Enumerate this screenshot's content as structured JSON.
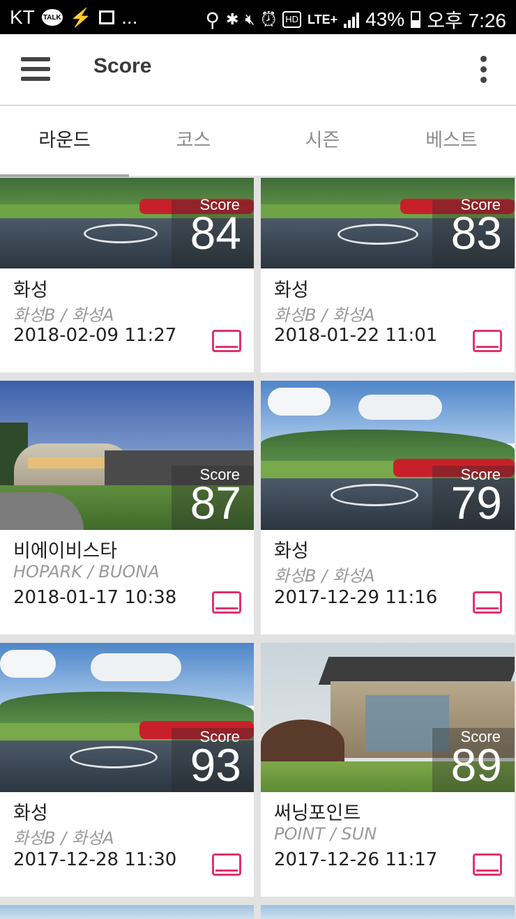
{
  "status_bar": {
    "carrier": "KT",
    "talk": "TALK",
    "more": "...",
    "hd": "HD",
    "lte": "LTE+",
    "battery": "43%",
    "time": "오후 7:26"
  },
  "app_bar": {
    "title": "Score"
  },
  "tabs": [
    {
      "label": "라운드",
      "active": true
    },
    {
      "label": "코스",
      "active": false
    },
    {
      "label": "시즌",
      "active": false
    },
    {
      "label": "베스트",
      "active": false
    }
  ],
  "score_label": "Score",
  "cards": [
    {
      "score": "84",
      "club": "화성",
      "course": "화성B / 화성A",
      "date": "2018-02-09 11:27",
      "scene": "fountain"
    },
    {
      "score": "83",
      "club": "화성",
      "course": "화성B / 화성A",
      "date": "2018-01-22 11:01",
      "scene": "fountain"
    },
    {
      "score": "87",
      "club": "비에이비스타",
      "course": "HOPARK / BUONA",
      "date": "2018-01-17 10:38",
      "scene": "clubhouse"
    },
    {
      "score": "79",
      "club": "화성",
      "course": "화성B / 화성A",
      "date": "2017-12-29 11:16",
      "scene": "fountain"
    },
    {
      "score": "93",
      "club": "화성",
      "course": "화성B / 화성A",
      "date": "2017-12-28 11:30",
      "scene": "fountain"
    },
    {
      "score": "89",
      "club": "써닝포인트",
      "course": "POINT / SUN",
      "date": "2017-12-26 11:17",
      "scene": "building"
    }
  ],
  "colors": {
    "accent": "#e0336d",
    "tab_indicator": "#a6a6a6",
    "app_bar_text": "#3a3a3a"
  }
}
